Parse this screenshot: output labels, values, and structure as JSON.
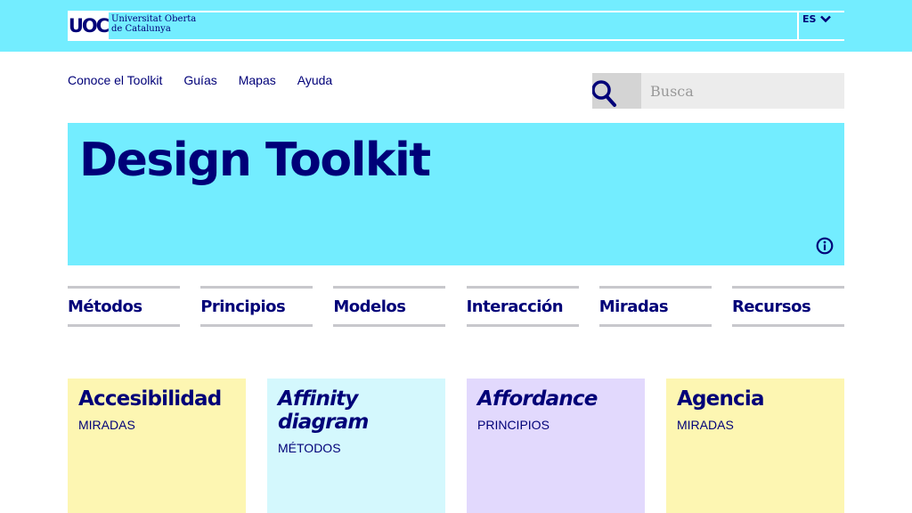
{
  "header": {
    "logo_text": "UOC",
    "university_name_line1": "Universitat Oberta",
    "university_name_line2": "de Catalunya",
    "language": "ES",
    "colors": {
      "bar": "#73edff",
      "text": "#000078"
    }
  },
  "nav": {
    "items": [
      "Conoce el Toolkit",
      "Guías",
      "Mapas",
      "Ayuda"
    ]
  },
  "search": {
    "placeholder": "Busca",
    "icon": "search-icon"
  },
  "hero": {
    "title": "Design Toolkit",
    "info_icon": "info-icon"
  },
  "categories": [
    "Métodos",
    "Principios",
    "Modelos",
    "Interacción",
    "Miradas",
    "Recursos"
  ],
  "cards": [
    {
      "title": "Accesibilidad",
      "category": "MIRADAS",
      "italic": false,
      "color": "#fdf6b2"
    },
    {
      "title": "Affinity diagram",
      "category": "MÉTODOS",
      "italic": true,
      "color": "#d4f8fd"
    },
    {
      "title": "Affordance",
      "category": "PRINCIPIOS",
      "italic": true,
      "color": "#e2d9fd"
    },
    {
      "title": "Agencia",
      "category": "MIRADAS",
      "italic": false,
      "color": "#fdf6b2"
    }
  ]
}
